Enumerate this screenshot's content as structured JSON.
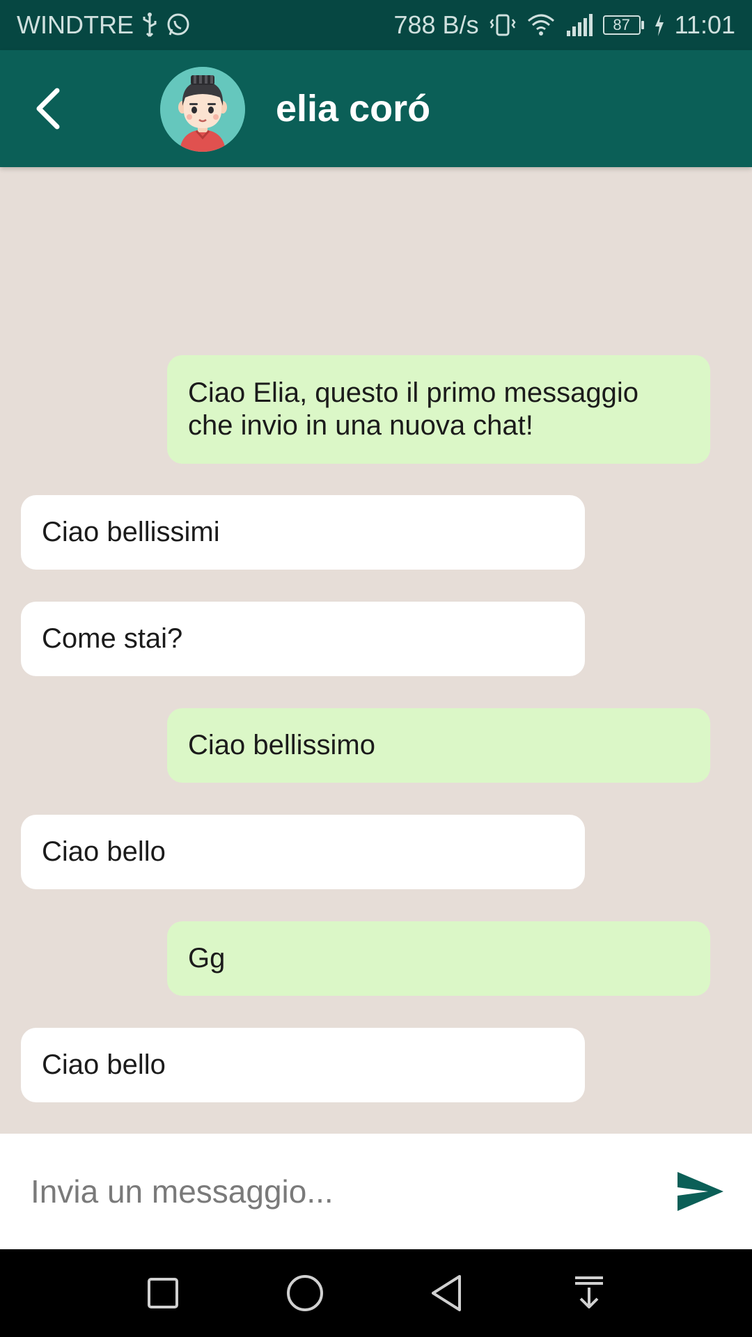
{
  "status_bar": {
    "carrier": "WINDTRE",
    "net_speed": "788 B/s",
    "battery": "87",
    "time": "11:01",
    "icons": [
      "usb-icon",
      "whatsapp-icon",
      "vibrate-icon",
      "wifi-icon",
      "signal-icon",
      "battery-icon",
      "charging-icon"
    ]
  },
  "header": {
    "title": "elia coró",
    "back_icon": "back-arrow-icon",
    "avatar": "user-avatar"
  },
  "messages": [
    {
      "side": "sent",
      "text": "Ciao Elia, questo  il primo messaggio che invio in una nuova chat!"
    },
    {
      "side": "received",
      "text": "Ciao bellissimi"
    },
    {
      "side": "received",
      "text": "Come stai?"
    },
    {
      "side": "sent",
      "text": "Ciao bellissimo"
    },
    {
      "side": "received",
      "text": "Ciao bello"
    },
    {
      "side": "sent",
      "text": "Gg"
    },
    {
      "side": "received",
      "text": "Ciao bello"
    }
  ],
  "composer": {
    "placeholder": "Invia un messaggio...",
    "value": "",
    "send_icon": "send-icon"
  },
  "nav_bar": {
    "icons": [
      "recents-icon",
      "home-icon",
      "back-icon",
      "notifications-pulldown-icon"
    ]
  },
  "colors": {
    "status_bar": "#064742",
    "app_bar": "#0b5f57",
    "chat_background": "#e6ddd7",
    "sent_bubble": "#dbf7c7",
    "received_bubble": "#ffffff",
    "send_accent": "#0b5f57"
  }
}
